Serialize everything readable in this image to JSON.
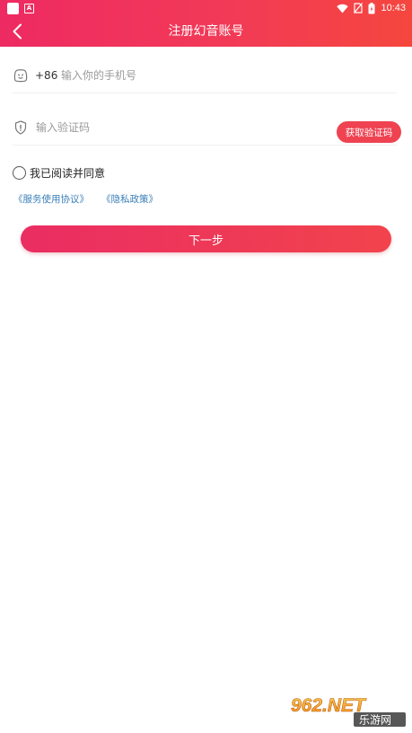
{
  "status_bar": {
    "time": "10:43"
  },
  "header": {
    "title": "注册幻音账号"
  },
  "phone": {
    "country_code": "+86",
    "placeholder": "输入你的手机号"
  },
  "code": {
    "placeholder": "输入验证码",
    "get_code_label": "获取验证码"
  },
  "agreement": {
    "text": "我已阅读并同意",
    "service_link": "《服务使用协议》",
    "privacy_link": "《隐私政策》"
  },
  "next_label": "下一步",
  "watermark": {
    "main": "962.NET",
    "sub": "乐游网"
  },
  "colors": {
    "accent": "#ef4352",
    "gradient_start": "#ee2a62",
    "gradient_end": "#f5463e",
    "link": "#3a7fb8"
  }
}
